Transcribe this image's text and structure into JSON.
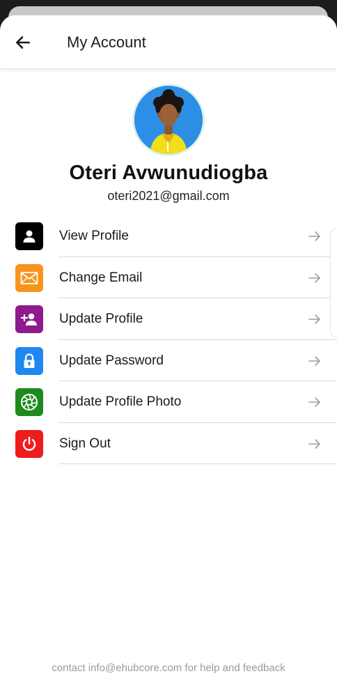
{
  "header": {
    "title": "My Account",
    "back_icon": "arrow-left-icon"
  },
  "profile": {
    "name": "Oteri Avwunudiogba",
    "email": "oteri2021@gmail.com",
    "avatar": "user-avatar-illustration"
  },
  "menu": {
    "items": [
      {
        "label": "View Profile",
        "icon": "person-icon",
        "color": "#000000"
      },
      {
        "label": "Change Email",
        "icon": "mail-icon",
        "color": "#f7941d"
      },
      {
        "label": "Update Profile",
        "icon": "add-person-icon",
        "color": "#8e1a8c"
      },
      {
        "label": "Update Password",
        "icon": "lock-icon",
        "color": "#1e88f0"
      },
      {
        "label": "Update Profile Photo",
        "icon": "camera-shutter-icon",
        "color": "#1e8a1e"
      },
      {
        "label": "Sign Out",
        "icon": "power-icon",
        "color": "#ee1c1c"
      }
    ],
    "trailing_icon": "arrow-right-icon"
  },
  "footer": {
    "text": "contact info@ehubcore.com for help and feedback"
  }
}
